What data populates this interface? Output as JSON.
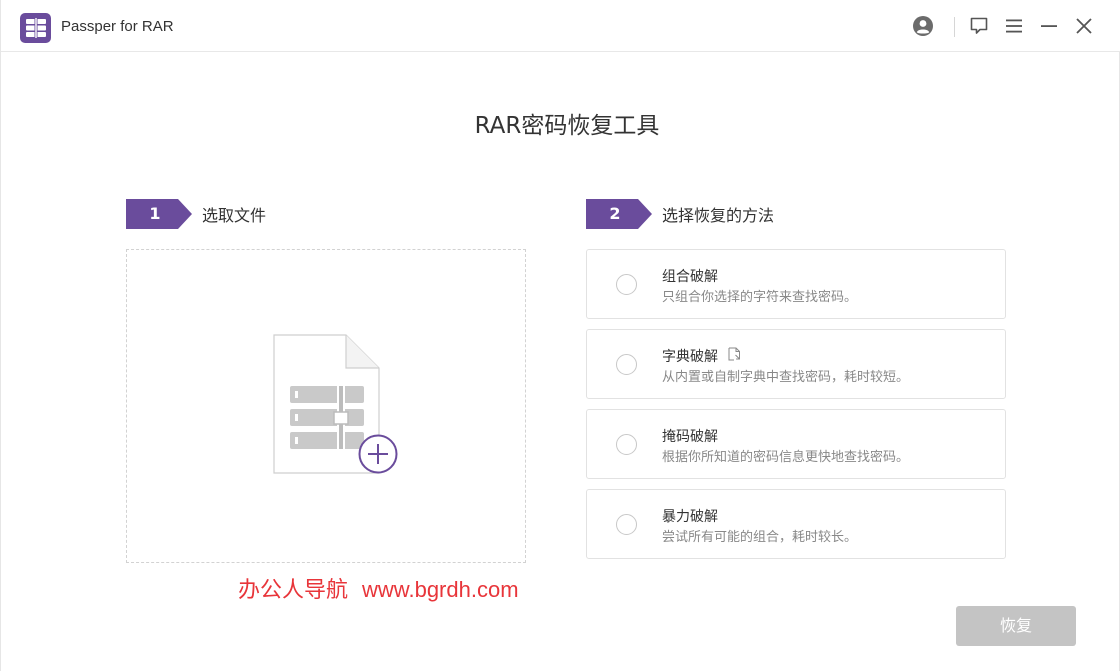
{
  "app": {
    "title": "Passper for RAR",
    "logo_icon": "rar-archive-icon",
    "accent": "#6a4c9c"
  },
  "titlebar": {
    "icons": [
      "account-icon",
      "feedback-icon",
      "menu-icon",
      "minimize-icon",
      "close-icon"
    ]
  },
  "headline": "RAR密码恢复工具",
  "step1": {
    "number": "1",
    "label": "选取文件"
  },
  "step2": {
    "number": "2",
    "label": "选择恢复的方法"
  },
  "dropzone": {
    "icon": "add-rar-file-icon"
  },
  "methods": [
    {
      "title": "组合破解",
      "desc": "只组合你选择的字符来查找密码。"
    },
    {
      "title": "字典破解",
      "desc": "从内置或自制字典中查找密码，耗时较短。",
      "extra_icon": "dictionary-file-icon"
    },
    {
      "title": "掩码破解",
      "desc": "根据你所知道的密码信息更快地查找密码。"
    },
    {
      "title": "暴力破解",
      "desc": "尝试所有可能的组合，耗时较长。"
    }
  ],
  "watermark": {
    "part1": "办公人导航",
    "part2": "www.bgrdh.com",
    "color": "#e8353a"
  },
  "recover_button": {
    "label": "恢复",
    "state": "disabled"
  }
}
